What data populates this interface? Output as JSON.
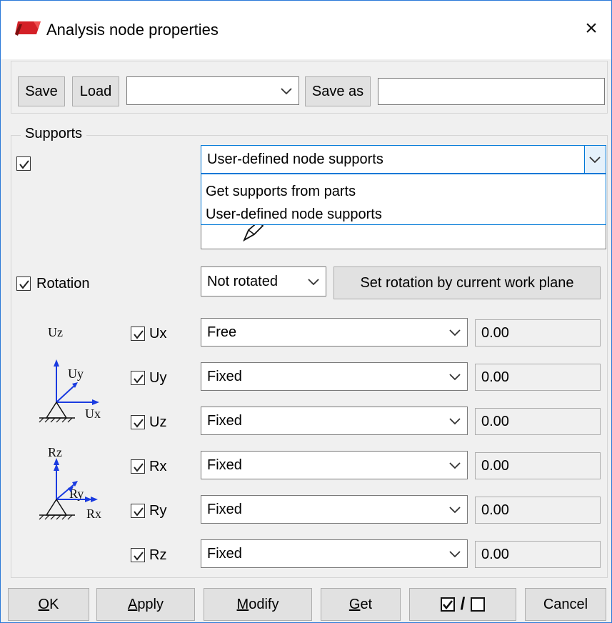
{
  "window": {
    "title": "Analysis node properties",
    "close_glyph": "×"
  },
  "toolbar": {
    "save_label": "Save",
    "load_label": "Load",
    "preset_value": "",
    "save_as_label": "Save as",
    "save_as_value": ""
  },
  "supports": {
    "group_label": "Supports",
    "enabled": true,
    "mode_selected": "User-defined node supports",
    "mode_options": [
      "Get supports from parts",
      "User-defined node supports"
    ]
  },
  "rotation": {
    "label": "Rotation",
    "enabled": true,
    "selected": "Not rotated",
    "set_by_work_plane_label": "Set rotation by current work plane"
  },
  "diagram": {
    "translation_axes": [
      "Uz",
      "Uy",
      "Ux"
    ],
    "rotation_axes": [
      "Rz",
      "Ry",
      "Rx"
    ]
  },
  "dofs": [
    {
      "label": "Ux",
      "checked": true,
      "condition": "Free",
      "value": "0.00"
    },
    {
      "label": "Uy",
      "checked": true,
      "condition": "Fixed",
      "value": "0.00"
    },
    {
      "label": "Uz",
      "checked": true,
      "condition": "Fixed",
      "value": "0.00"
    },
    {
      "label": "Rx",
      "checked": true,
      "condition": "Fixed",
      "value": "0.00"
    },
    {
      "label": "Ry",
      "checked": true,
      "condition": "Fixed",
      "value": "0.00"
    },
    {
      "label": "Rz",
      "checked": true,
      "condition": "Fixed",
      "value": "0.00"
    }
  ],
  "footer": {
    "ok": {
      "mnemonic": "O",
      "rest": "K"
    },
    "apply": {
      "mnemonic": "A",
      "rest": "pply"
    },
    "modify": {
      "mnemonic": "M",
      "rest": "odify"
    },
    "get": {
      "mnemonic": "G",
      "rest": "et"
    },
    "toggle_separator": "/",
    "cancel": "Cancel"
  },
  "colors": {
    "accent": "#0078d7",
    "dropdown_border": "#0078d7",
    "dialog_border": "#2b79d8",
    "axis_blue": "#1a3be0",
    "logo_red": "#d42027"
  }
}
